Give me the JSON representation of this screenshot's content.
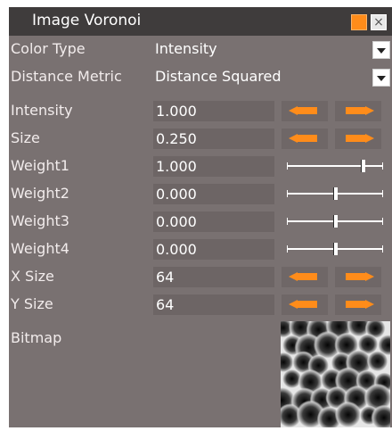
{
  "window": {
    "title": "Image Voronoi",
    "minimize_color": "#ff8c1a",
    "close_label": "×"
  },
  "properties": {
    "color_type": {
      "label": "Color Type",
      "value": "Intensity"
    },
    "distance_metric": {
      "label": "Distance Metric",
      "value": "Distance Squared"
    },
    "intensity": {
      "label": "Intensity",
      "value": "1.000"
    },
    "size": {
      "label": "Size",
      "value": "0.250"
    },
    "weight1": {
      "label": "Weight1",
      "value": "1.000",
      "level": 0.8
    },
    "weight2": {
      "label": "Weight2",
      "value": "0.000",
      "level": 0.5
    },
    "weight3": {
      "label": "Weight3",
      "value": "0.000",
      "level": 0.5
    },
    "weight4": {
      "label": "Weight4",
      "value": "0.000",
      "level": 0.5
    },
    "x_size": {
      "label": "X Size",
      "value": "64"
    },
    "y_size": {
      "label": "Y Size",
      "value": "64"
    },
    "bitmap": {
      "label": "Bitmap"
    }
  },
  "icons": {
    "decrement": "orange-left-arrow-icon",
    "increment": "orange-right-arrow-icon",
    "dropdown": "chevron-down-icon"
  },
  "colors": {
    "panel_bg": "#797171",
    "titlebar_bg": "#3f3c3c",
    "accent": "#ff8c1a"
  }
}
